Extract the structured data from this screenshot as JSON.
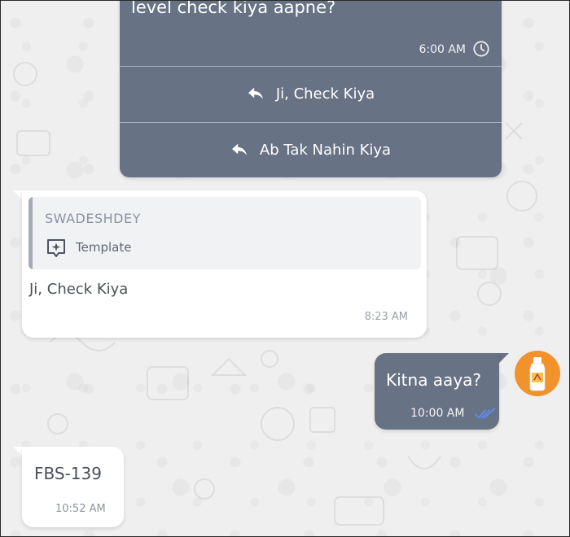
{
  "template_message": {
    "body_text": "level check kiya aapne?",
    "time": "6:00 AM",
    "buttons": [
      {
        "label": "Ji, Check Kiya"
      },
      {
        "label": "Ab Tak Nahin Kiya"
      }
    ]
  },
  "reply_message": {
    "quote": {
      "sender": "SWADESHDEY",
      "type_label": "Template"
    },
    "text": "Ji, Check Kiya",
    "time": "8:23 AM"
  },
  "outgoing_message": {
    "text": "Kitna aaya?",
    "time": "10:00 AM",
    "status": "read"
  },
  "incoming_message_2": {
    "text": "FBS-139",
    "time": "10:52 AM"
  },
  "colors": {
    "bubble_dark": "#687285",
    "bubble_light": "#ffffff",
    "read_tick": "#5b8def",
    "avatar_bg": "#f2922a"
  }
}
